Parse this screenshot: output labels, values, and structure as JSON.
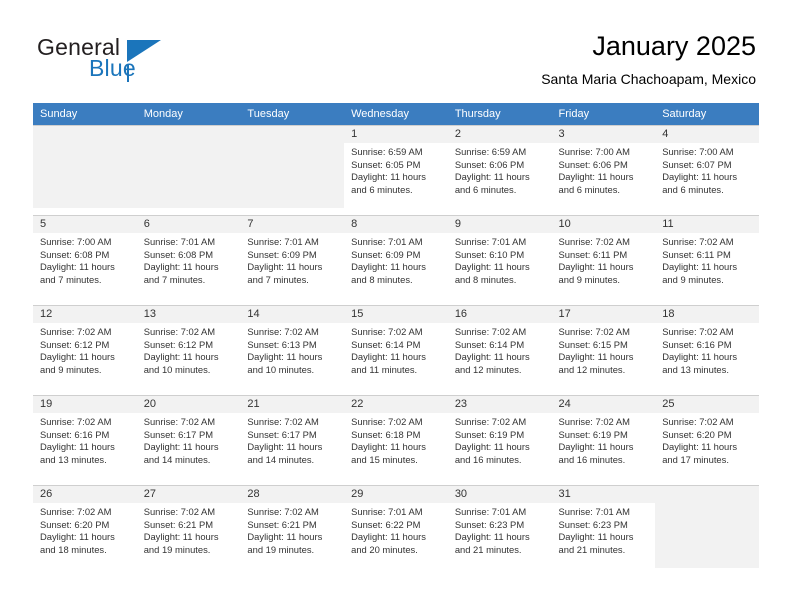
{
  "brand": {
    "name_part1": "General",
    "name_part2": "Blue",
    "accent_color": "#1b75bb"
  },
  "header": {
    "title": "January 2025",
    "subtitle": "Santa Maria Chachoapam, Mexico"
  },
  "theme": {
    "header_row_color": "#3b7dc0",
    "daynum_band_color": "#f2f2f2",
    "empty_cell_color": "#f2f2f2",
    "grid_line_color": "#cfcfcf"
  },
  "weekdays": [
    "Sunday",
    "Monday",
    "Tuesday",
    "Wednesday",
    "Thursday",
    "Friday",
    "Saturday"
  ],
  "weeks": [
    [
      {
        "day": "",
        "sunrise": "",
        "sunset": "",
        "daylight1": "",
        "daylight2": ""
      },
      {
        "day": "",
        "sunrise": "",
        "sunset": "",
        "daylight1": "",
        "daylight2": ""
      },
      {
        "day": "",
        "sunrise": "",
        "sunset": "",
        "daylight1": "",
        "daylight2": ""
      },
      {
        "day": "1",
        "sunrise": "Sunrise: 6:59 AM",
        "sunset": "Sunset: 6:05 PM",
        "daylight1": "Daylight: 11 hours",
        "daylight2": "and 6 minutes."
      },
      {
        "day": "2",
        "sunrise": "Sunrise: 6:59 AM",
        "sunset": "Sunset: 6:06 PM",
        "daylight1": "Daylight: 11 hours",
        "daylight2": "and 6 minutes."
      },
      {
        "day": "3",
        "sunrise": "Sunrise: 7:00 AM",
        "sunset": "Sunset: 6:06 PM",
        "daylight1": "Daylight: 11 hours",
        "daylight2": "and 6 minutes."
      },
      {
        "day": "4",
        "sunrise": "Sunrise: 7:00 AM",
        "sunset": "Sunset: 6:07 PM",
        "daylight1": "Daylight: 11 hours",
        "daylight2": "and 6 minutes."
      }
    ],
    [
      {
        "day": "5",
        "sunrise": "Sunrise: 7:00 AM",
        "sunset": "Sunset: 6:08 PM",
        "daylight1": "Daylight: 11 hours",
        "daylight2": "and 7 minutes."
      },
      {
        "day": "6",
        "sunrise": "Sunrise: 7:01 AM",
        "sunset": "Sunset: 6:08 PM",
        "daylight1": "Daylight: 11 hours",
        "daylight2": "and 7 minutes."
      },
      {
        "day": "7",
        "sunrise": "Sunrise: 7:01 AM",
        "sunset": "Sunset: 6:09 PM",
        "daylight1": "Daylight: 11 hours",
        "daylight2": "and 7 minutes."
      },
      {
        "day": "8",
        "sunrise": "Sunrise: 7:01 AM",
        "sunset": "Sunset: 6:09 PM",
        "daylight1": "Daylight: 11 hours",
        "daylight2": "and 8 minutes."
      },
      {
        "day": "9",
        "sunrise": "Sunrise: 7:01 AM",
        "sunset": "Sunset: 6:10 PM",
        "daylight1": "Daylight: 11 hours",
        "daylight2": "and 8 minutes."
      },
      {
        "day": "10",
        "sunrise": "Sunrise: 7:02 AM",
        "sunset": "Sunset: 6:11 PM",
        "daylight1": "Daylight: 11 hours",
        "daylight2": "and 9 minutes."
      },
      {
        "day": "11",
        "sunrise": "Sunrise: 7:02 AM",
        "sunset": "Sunset: 6:11 PM",
        "daylight1": "Daylight: 11 hours",
        "daylight2": "and 9 minutes."
      }
    ],
    [
      {
        "day": "12",
        "sunrise": "Sunrise: 7:02 AM",
        "sunset": "Sunset: 6:12 PM",
        "daylight1": "Daylight: 11 hours",
        "daylight2": "and 9 minutes."
      },
      {
        "day": "13",
        "sunrise": "Sunrise: 7:02 AM",
        "sunset": "Sunset: 6:12 PM",
        "daylight1": "Daylight: 11 hours",
        "daylight2": "and 10 minutes."
      },
      {
        "day": "14",
        "sunrise": "Sunrise: 7:02 AM",
        "sunset": "Sunset: 6:13 PM",
        "daylight1": "Daylight: 11 hours",
        "daylight2": "and 10 minutes."
      },
      {
        "day": "15",
        "sunrise": "Sunrise: 7:02 AM",
        "sunset": "Sunset: 6:14 PM",
        "daylight1": "Daylight: 11 hours",
        "daylight2": "and 11 minutes."
      },
      {
        "day": "16",
        "sunrise": "Sunrise: 7:02 AM",
        "sunset": "Sunset: 6:14 PM",
        "daylight1": "Daylight: 11 hours",
        "daylight2": "and 12 minutes."
      },
      {
        "day": "17",
        "sunrise": "Sunrise: 7:02 AM",
        "sunset": "Sunset: 6:15 PM",
        "daylight1": "Daylight: 11 hours",
        "daylight2": "and 12 minutes."
      },
      {
        "day": "18",
        "sunrise": "Sunrise: 7:02 AM",
        "sunset": "Sunset: 6:16 PM",
        "daylight1": "Daylight: 11 hours",
        "daylight2": "and 13 minutes."
      }
    ],
    [
      {
        "day": "19",
        "sunrise": "Sunrise: 7:02 AM",
        "sunset": "Sunset: 6:16 PM",
        "daylight1": "Daylight: 11 hours",
        "daylight2": "and 13 minutes."
      },
      {
        "day": "20",
        "sunrise": "Sunrise: 7:02 AM",
        "sunset": "Sunset: 6:17 PM",
        "daylight1": "Daylight: 11 hours",
        "daylight2": "and 14 minutes."
      },
      {
        "day": "21",
        "sunrise": "Sunrise: 7:02 AM",
        "sunset": "Sunset: 6:17 PM",
        "daylight1": "Daylight: 11 hours",
        "daylight2": "and 14 minutes."
      },
      {
        "day": "22",
        "sunrise": "Sunrise: 7:02 AM",
        "sunset": "Sunset: 6:18 PM",
        "daylight1": "Daylight: 11 hours",
        "daylight2": "and 15 minutes."
      },
      {
        "day": "23",
        "sunrise": "Sunrise: 7:02 AM",
        "sunset": "Sunset: 6:19 PM",
        "daylight1": "Daylight: 11 hours",
        "daylight2": "and 16 minutes."
      },
      {
        "day": "24",
        "sunrise": "Sunrise: 7:02 AM",
        "sunset": "Sunset: 6:19 PM",
        "daylight1": "Daylight: 11 hours",
        "daylight2": "and 16 minutes."
      },
      {
        "day": "25",
        "sunrise": "Sunrise: 7:02 AM",
        "sunset": "Sunset: 6:20 PM",
        "daylight1": "Daylight: 11 hours",
        "daylight2": "and 17 minutes."
      }
    ],
    [
      {
        "day": "26",
        "sunrise": "Sunrise: 7:02 AM",
        "sunset": "Sunset: 6:20 PM",
        "daylight1": "Daylight: 11 hours",
        "daylight2": "and 18 minutes."
      },
      {
        "day": "27",
        "sunrise": "Sunrise: 7:02 AM",
        "sunset": "Sunset: 6:21 PM",
        "daylight1": "Daylight: 11 hours",
        "daylight2": "and 19 minutes."
      },
      {
        "day": "28",
        "sunrise": "Sunrise: 7:02 AM",
        "sunset": "Sunset: 6:21 PM",
        "daylight1": "Daylight: 11 hours",
        "daylight2": "and 19 minutes."
      },
      {
        "day": "29",
        "sunrise": "Sunrise: 7:01 AM",
        "sunset": "Sunset: 6:22 PM",
        "daylight1": "Daylight: 11 hours",
        "daylight2": "and 20 minutes."
      },
      {
        "day": "30",
        "sunrise": "Sunrise: 7:01 AM",
        "sunset": "Sunset: 6:23 PM",
        "daylight1": "Daylight: 11 hours",
        "daylight2": "and 21 minutes."
      },
      {
        "day": "31",
        "sunrise": "Sunrise: 7:01 AM",
        "sunset": "Sunset: 6:23 PM",
        "daylight1": "Daylight: 11 hours",
        "daylight2": "and 21 minutes."
      },
      {
        "day": "",
        "sunrise": "",
        "sunset": "",
        "daylight1": "",
        "daylight2": ""
      }
    ]
  ]
}
